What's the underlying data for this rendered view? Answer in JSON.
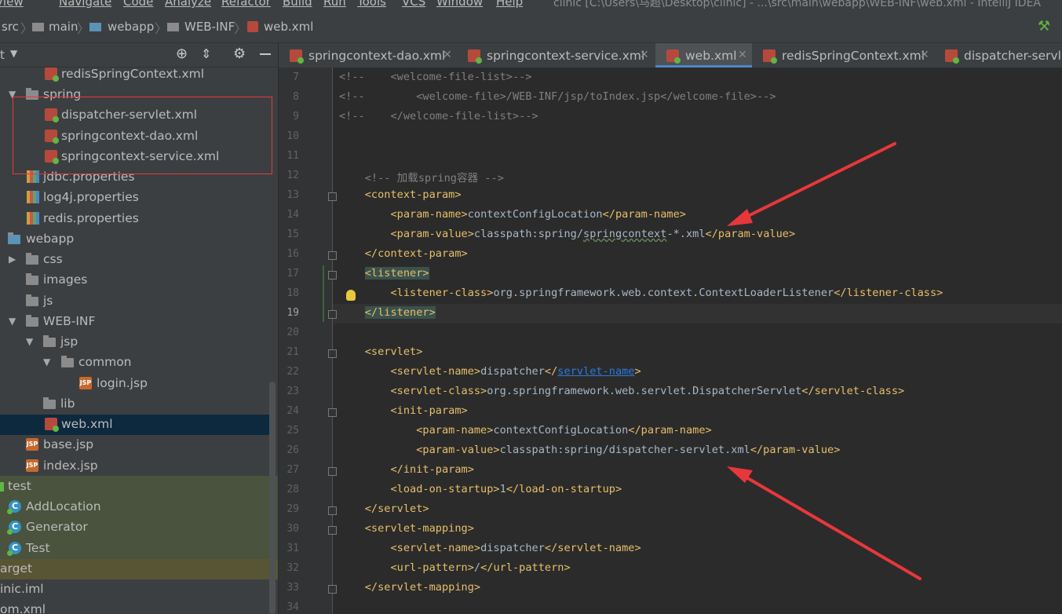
{
  "menu": {
    "items": [
      "View",
      "Navigate",
      "Code",
      "Analyze",
      "Refactor",
      "Build",
      "Run",
      "Tools",
      "VCS",
      "Window",
      "Help"
    ],
    "window_title": "clinic [C:\\Users\\马超\\Desktop\\clinic] - ...\\src\\main\\webapp\\WEB-INF\\web.xml - IntelliJ IDEA"
  },
  "breadcrumb": {
    "items": [
      "src",
      "main",
      "webapp",
      "WEB-INF",
      "web.xml"
    ]
  },
  "project_panel": {
    "title": "t",
    "rows": [
      {
        "label": "redisSpringContext.xml",
        "icon": "xml-file-icon"
      },
      {
        "label": "spring",
        "icon": "folder-icon"
      },
      {
        "label": "dispatcher-servlet.xml",
        "icon": "xml-file-icon"
      },
      {
        "label": "springcontext-dao.xml",
        "icon": "xml-file-icon"
      },
      {
        "label": "springcontext-service.xml",
        "icon": "xml-file-icon"
      },
      {
        "label": "jdbc.properties",
        "icon": "properties-file-icon"
      },
      {
        "label": "log4j.properties",
        "icon": "properties-file-icon"
      },
      {
        "label": "redis.properties",
        "icon": "properties-file-icon"
      },
      {
        "label": "webapp",
        "icon": "web-folder-icon"
      },
      {
        "label": "css",
        "icon": "folder-icon"
      },
      {
        "label": "images",
        "icon": "folder-icon"
      },
      {
        "label": "js",
        "icon": "folder-icon"
      },
      {
        "label": "WEB-INF",
        "icon": "folder-icon"
      },
      {
        "label": "jsp",
        "icon": "folder-icon"
      },
      {
        "label": "common",
        "icon": "folder-icon"
      },
      {
        "label": "login.jsp",
        "icon": "jsp-file-icon"
      },
      {
        "label": "lib",
        "icon": "folder-icon"
      },
      {
        "label": "web.xml",
        "icon": "xml-file-icon"
      },
      {
        "label": "base.jsp",
        "icon": "jsp-file-icon"
      },
      {
        "label": "index.jsp",
        "icon": "jsp-file-icon"
      },
      {
        "label": "test",
        "icon": "test-folder-icon"
      },
      {
        "label": "AddLocation",
        "icon": "class-icon"
      },
      {
        "label": "Generator",
        "icon": "class-icon"
      },
      {
        "label": "Test",
        "icon": "class-icon"
      },
      {
        "label": "arget",
        "icon": "folder-icon"
      },
      {
        "label": "inic.iml",
        "icon": "iml-file-icon"
      },
      {
        "label": "om.xml",
        "icon": "xml-file-icon"
      }
    ]
  },
  "tabs": [
    {
      "label": "springcontext-dao.xml",
      "active": false
    },
    {
      "label": "springcontext-service.xml",
      "active": false
    },
    {
      "label": "web.xml",
      "active": true
    },
    {
      "label": "redisSpringContext.xml",
      "active": false
    },
    {
      "label": "dispatcher-servle",
      "active": false
    }
  ],
  "editor": {
    "line_numbers": [
      "7",
      "8",
      "9",
      "10",
      "11",
      "12",
      "13",
      "14",
      "15",
      "16",
      "17",
      "18",
      "19",
      "20",
      "21",
      "22",
      "23",
      "24",
      "25",
      "26",
      "27",
      "28",
      "29",
      "30",
      "31",
      "32",
      "33",
      "34"
    ],
    "lines": [
      "<!--    <welcome-file-list>-->",
      "<!--        <welcome-file>/WEB-INF/jsp/toIndex.jsp</welcome-file>-->",
      "<!--    </welcome-file-list>-->",
      "",
      "",
      "    <!-- 加载spring容器 -->",
      "    <context-param>",
      "        <param-name>contextConfigLocation</param-name>",
      "        <param-value>classpath:spring/springcontext-*.xml</param-value>",
      "    </context-param>",
      "    <listener>",
      "        <listener-class>org.springframework.web.context.ContextLoaderListener</listener-class>",
      "    </listener>",
      "",
      "    <servlet>",
      "        <servlet-name>dispatcher</servlet-name>",
      "        <servlet-class>org.springframework.web.servlet.DispatcherServlet</servlet-class>",
      "        <init-param>",
      "            <param-name>contextConfigLocation</param-name>",
      "            <param-value>classpath:spring/dispatcher-servlet.xml</param-value>",
      "        </init-param>",
      "        <load-on-startup>1</load-on-startup>",
      "    </servlet>",
      "    <servlet-mapping>",
      "        <servlet-name>dispatcher</servlet-name>",
      "        <url-pattern>/</url-pattern>",
      "    </servlet-mapping>",
      ""
    ]
  },
  "colors": {
    "annotation_red": "#e8373b",
    "tag": "#e8bf6a",
    "comment": "#808080",
    "text": "#a9b7c6",
    "selection": "#0d293e"
  }
}
